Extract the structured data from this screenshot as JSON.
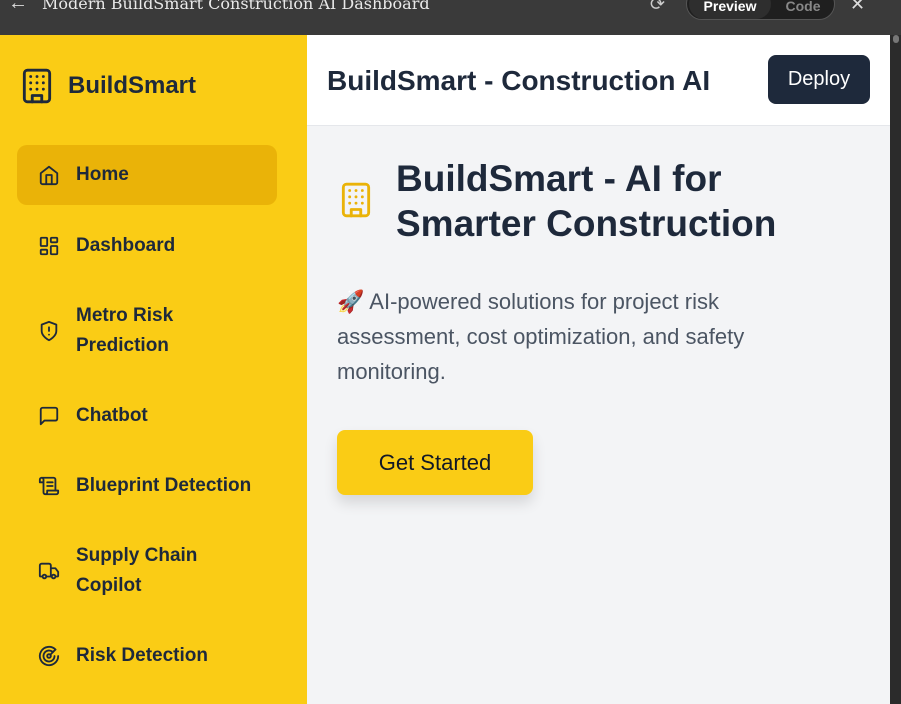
{
  "window": {
    "title": "Modern BuildSmart Construction AI Dashboard",
    "tabs": {
      "preview": "Preview",
      "code": "Code"
    }
  },
  "sidebar": {
    "brand": "BuildSmart",
    "items": [
      {
        "label": "Home",
        "icon": "home-icon",
        "active": true
      },
      {
        "label": "Dashboard",
        "icon": "dashboard-grid-icon"
      },
      {
        "label": "Metro Risk Prediction",
        "icon": "shield-alert-icon"
      },
      {
        "label": "Chatbot",
        "icon": "message-icon"
      },
      {
        "label": "Blueprint Detection",
        "icon": "scroll-icon"
      },
      {
        "label": "Supply Chain Copilot",
        "icon": "truck-icon"
      },
      {
        "label": "Risk Detection",
        "icon": "radar-icon"
      }
    ]
  },
  "header": {
    "title": "BuildSmart - Construction AI",
    "deploy_label": "Deploy"
  },
  "main": {
    "hero_title": "BuildSmart - AI for Smarter Construction",
    "hero_subtitle": "🚀 AI-powered solutions for project risk assessment, cost optimization, and safety monitoring.",
    "cta_label": "Get Started"
  },
  "colors": {
    "sidebar_bg": "#facc15",
    "active_item": "#eab308",
    "text_dark": "#1e293b",
    "deploy_bg": "#1e293b",
    "main_bg": "#f3f4f6"
  }
}
